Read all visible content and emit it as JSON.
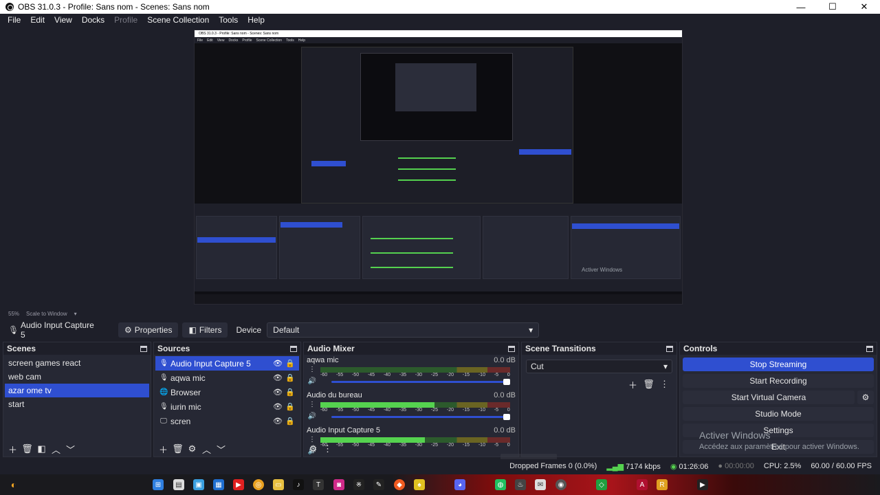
{
  "window": {
    "title": "OBS 31.0.3 - Profile: Sans nom - Scenes: Sans nom",
    "minimize": "—",
    "maximize": "☐",
    "close": "✕"
  },
  "menu": [
    "File",
    "Edit",
    "View",
    "Docks",
    "Profile",
    "Scene Collection",
    "Tools",
    "Help"
  ],
  "preview": {
    "zoom": "55%",
    "scale_mode": "Scale to Window",
    "nested_title": "OBS 31.0.3 - Profile: Sans nom - Scenes: Sans nom",
    "nested_menu": [
      "File",
      "Edit",
      "View",
      "Docks",
      "Profile",
      "Scene Collection",
      "Tools",
      "Help"
    ],
    "nested_watermark": "Activer Windows"
  },
  "source_toolbar": {
    "source_name": "Audio Input Capture 5",
    "properties_label": "Properties",
    "filters_label": "Filters",
    "device_label": "Device",
    "device_value": "Default"
  },
  "scenes": {
    "title": "Scenes",
    "items": [
      "screen games react",
      "web cam",
      "azar ome tv",
      "start"
    ],
    "selected_index": 2
  },
  "sources": {
    "title": "Sources",
    "items": [
      {
        "name": "Audio Input Capture 5",
        "icon": "mic-icon",
        "selected": true
      },
      {
        "name": "aqwa mic",
        "icon": "mic-icon",
        "selected": false
      },
      {
        "name": "Browser",
        "icon": "globe-icon",
        "selected": false
      },
      {
        "name": "iurin mic",
        "icon": "mic-icon",
        "selected": false
      },
      {
        "name": "scren",
        "icon": "monitor-icon",
        "selected": false
      }
    ]
  },
  "audio_mixer": {
    "title": "Audio Mixer",
    "channels": [
      {
        "name": "aqwa mic",
        "db": "0.0 dB",
        "level": 0
      },
      {
        "name": "Audio du bureau",
        "db": "0.0 dB",
        "level": 0.6
      },
      {
        "name": "Audio Input Capture 5",
        "db": "0.0 dB",
        "level": 0.55
      }
    ],
    "ticks": [
      "-60",
      "-55",
      "-50",
      "-45",
      "-40",
      "-35",
      "-30",
      "-25",
      "-20",
      "-15",
      "-10",
      "-5",
      "0"
    ]
  },
  "scene_transitions": {
    "title": "Scene Transitions",
    "value": "Cut"
  },
  "controls": {
    "title": "Controls",
    "stop_streaming": "Stop Streaming",
    "start_recording": "Start Recording",
    "start_virtual_camera": "Start Virtual Camera",
    "studio_mode": "Studio Mode",
    "settings": "Settings",
    "exit": "Exit"
  },
  "watermark": {
    "line1": "Activer Windows",
    "line2": "Accédez aux paramètres pour activer Windows."
  },
  "status": {
    "dropped_frames": "Dropped Frames 0 (0.0%)",
    "bitrate": "7174 kbps",
    "stream_time": "01:26:06",
    "record_time": "00:00:00",
    "cpu": "CPU: 2.5%",
    "fps": "60.00 / 60.00 FPS"
  },
  "colors": {
    "accent": "#2f4fd0",
    "panel": "#262834",
    "background": "#1e1f29"
  }
}
